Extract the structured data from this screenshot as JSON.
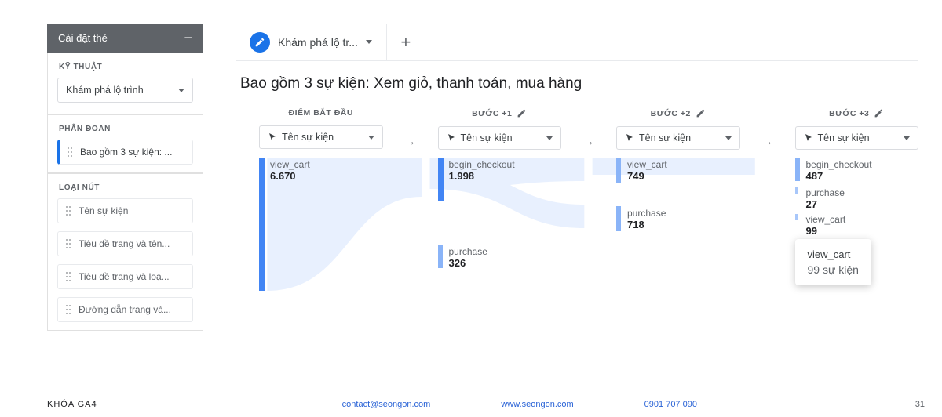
{
  "sidebar": {
    "header": "Cài đặt thẻ",
    "technique_label": "KỸ THUẬT",
    "technique_value": "Khám phá lộ trình",
    "segment_label": "PHÂN ĐOẠN",
    "segment_item": "Bao gồm 3 sự kiện: ...",
    "node_type_label": "LOẠI NÚT",
    "node_type_items": [
      "Tên sự kiện",
      "Tiêu đề trang và tên...",
      "Tiêu đề trang và loạ...",
      "Đường dẫn trang và..."
    ]
  },
  "tab": {
    "name": "Khám phá lộ tr..."
  },
  "page_title": "Bao gồm 3 sự kiện: Xem giỏ, thanh toán, mua hàng",
  "steps": {
    "labels": [
      "ĐIỂM BẮT ĐẦU",
      "BƯỚC +1",
      "BƯỚC +2",
      "BƯỚC +3"
    ],
    "dd": "Tên sự kiện"
  },
  "chart_data": {
    "type": "sankey",
    "columns": [
      {
        "step": "start",
        "nodes": [
          {
            "name": "view_cart",
            "value": 6670,
            "display": "6.670"
          }
        ]
      },
      {
        "step": "+1",
        "nodes": [
          {
            "name": "begin_checkout",
            "value": 1998,
            "display": "1.998"
          },
          {
            "name": "purchase",
            "value": 326,
            "display": "326"
          }
        ]
      },
      {
        "step": "+2",
        "nodes": [
          {
            "name": "view_cart",
            "value": 749,
            "display": "749"
          },
          {
            "name": "purchase",
            "value": 718,
            "display": "718"
          }
        ]
      },
      {
        "step": "+3",
        "nodes": [
          {
            "name": "begin_checkout",
            "value": 487,
            "display": "487"
          },
          {
            "name": "purchase",
            "value": 27,
            "display": "27"
          },
          {
            "name": "view_cart",
            "value": 99,
            "display": "99"
          }
        ]
      }
    ]
  },
  "tooltip": {
    "name": "view_cart",
    "value": "99 sự kiện"
  },
  "footer": {
    "course": "KHÓA GA4",
    "email": "contact@seongon.com",
    "site": "www.seongon.com",
    "phone": "0901 707 090",
    "page": "31"
  }
}
